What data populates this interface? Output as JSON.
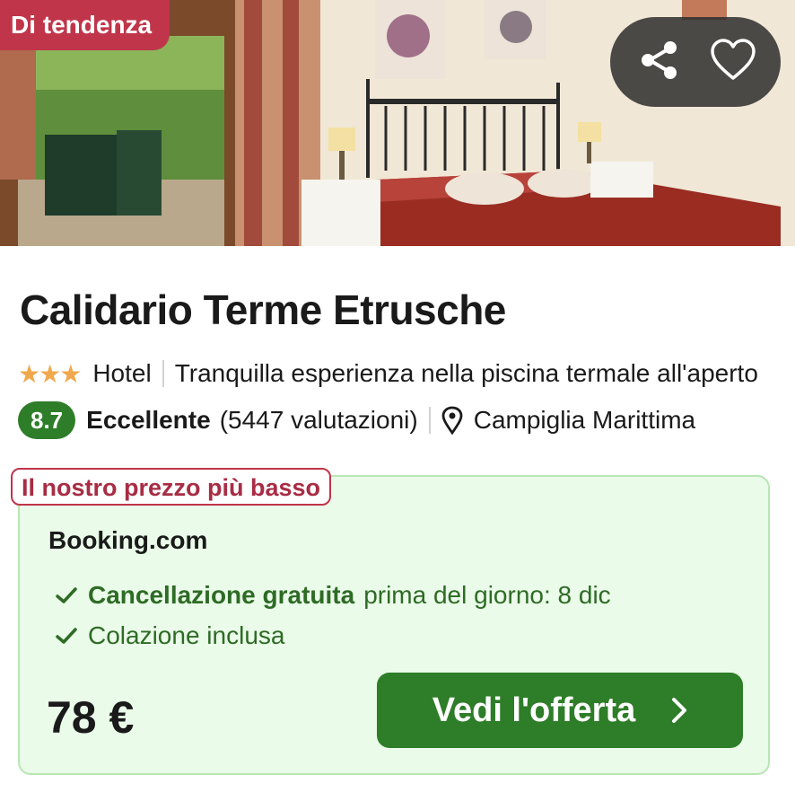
{
  "badge": {
    "label": "Di tendenza"
  },
  "actions": {
    "share_icon": "share-icon",
    "favorite_icon": "heart-icon"
  },
  "hotel": {
    "name": "Calidario Terme Etrusche",
    "stars_glyph": "★★★",
    "star_count": 3,
    "type": "Hotel",
    "description": "Tranquilla esperienza nella piscina termale all'aperto",
    "rating": {
      "score": "8.7",
      "verdict": "Eccellente",
      "reviews": "(5447 valutazioni)"
    },
    "location": "Campiglia Marittima"
  },
  "offer": {
    "badge": "Il nostro prezzo più basso",
    "provider": "Booking.com",
    "perks": [
      {
        "bold": "Cancellazione gratuita",
        "text": "prima del giorno: 8 dic"
      },
      {
        "bold": "",
        "text": "Colazione inclusa"
      }
    ],
    "price": "78 €",
    "cta": "Vedi l'offerta"
  },
  "colors": {
    "trend_badge": "#c0354a",
    "score_badge": "#2e7d28",
    "cta": "#2e7d28",
    "offer_background": "#eafbe9",
    "perk_text": "#2e6b25",
    "stars": "#f0a84d"
  }
}
